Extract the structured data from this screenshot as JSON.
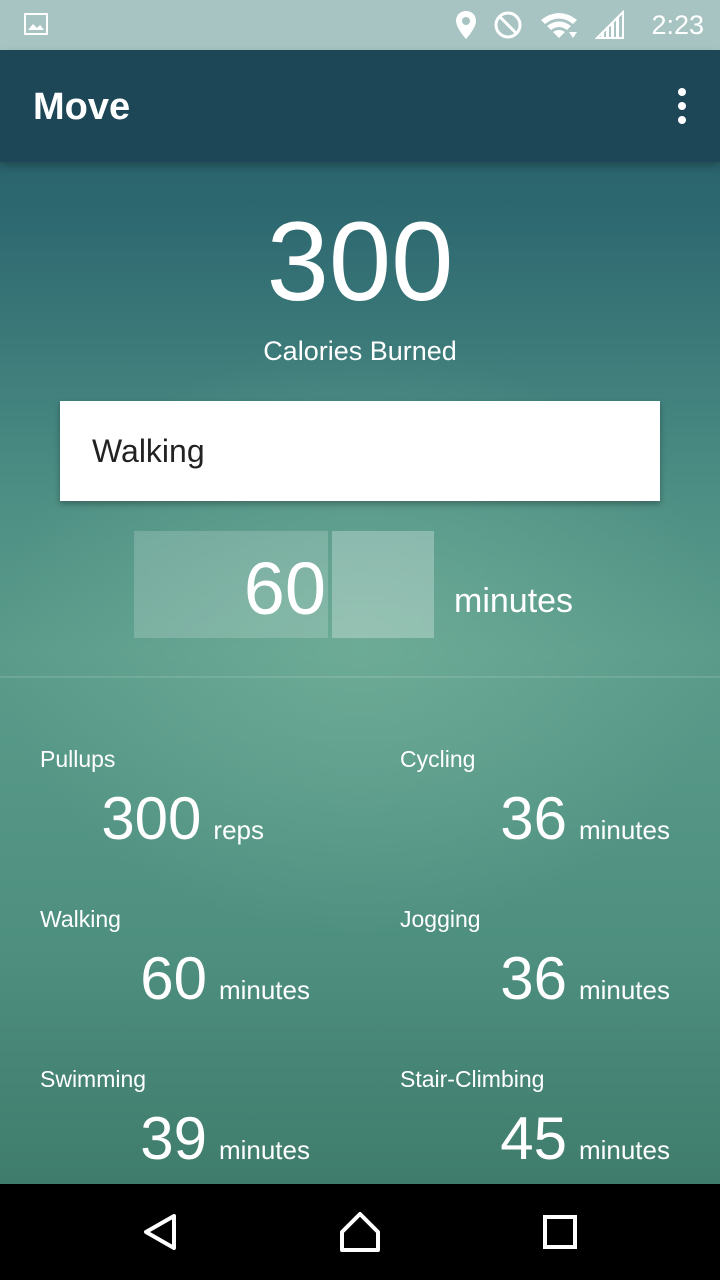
{
  "status_bar": {
    "time": "2:23",
    "icons": [
      "image-icon",
      "location-icon",
      "do-not-disturb-icon",
      "wifi-icon",
      "signal-icon"
    ]
  },
  "app_bar": {
    "title": "Move",
    "menu_icon": "more-vert-icon"
  },
  "summary": {
    "calories_value": "300",
    "calories_label": "Calories Burned"
  },
  "input": {
    "activity": "Walking",
    "amount": "60",
    "unit": "minutes"
  },
  "equivalents": [
    {
      "name": "Pullups",
      "value": "300",
      "unit": "reps"
    },
    {
      "name": "Cycling",
      "value": "36",
      "unit": "minutes"
    },
    {
      "name": "Walking",
      "value": "60",
      "unit": "minutes"
    },
    {
      "name": "Jogging",
      "value": "36",
      "unit": "minutes"
    },
    {
      "name": "Swimming",
      "value": "39",
      "unit": "minutes"
    },
    {
      "name": "Stair-Climbing",
      "value": "45",
      "unit": "minutes"
    }
  ],
  "nav_bar": {
    "icons": [
      "back-icon",
      "home-icon",
      "recents-icon"
    ]
  },
  "colors": {
    "status_bar": "#a7c4c3",
    "app_bar": "#1d4757",
    "background_top": "#235564",
    "background_mid": "#5a9b8a"
  }
}
